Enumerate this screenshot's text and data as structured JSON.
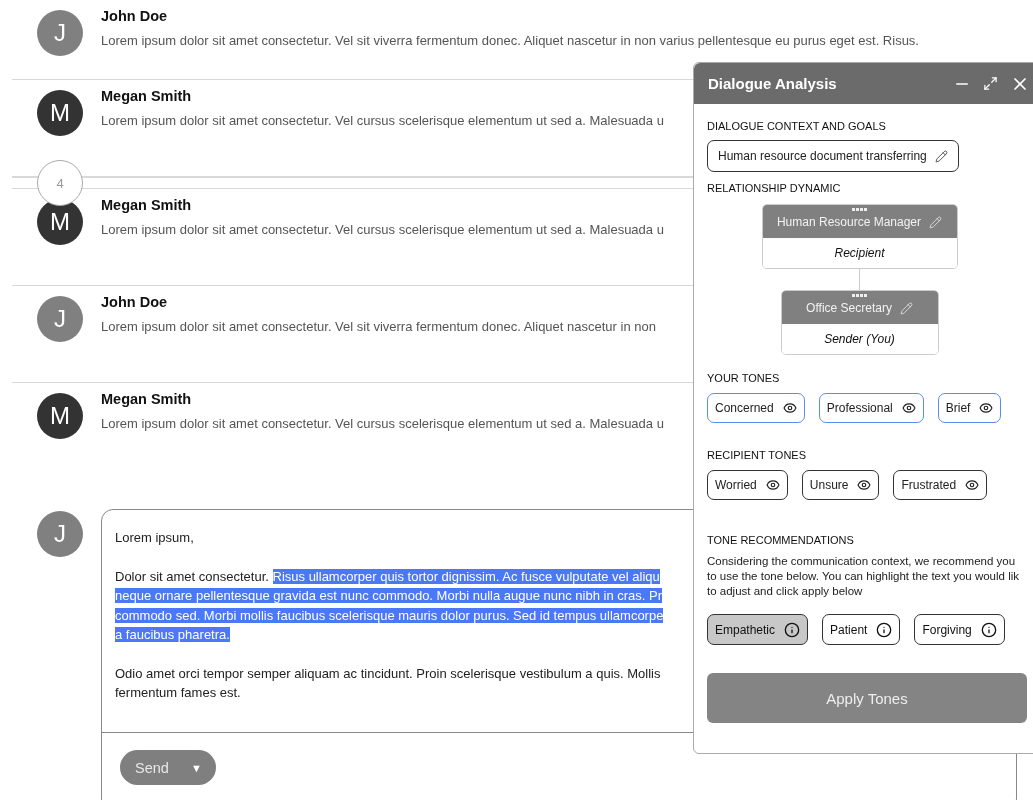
{
  "messages": [
    {
      "kind": "message",
      "author": "John Doe",
      "initial": "J",
      "color": "#808080",
      "text": "Lorem ipsum dolor sit amet consectetur. Vel sit viverra fermentum donec. Aliquet nascetur in non varius pellentesque eu purus eget est. Risus."
    },
    {
      "kind": "message",
      "author": "Megan Smith",
      "initial": "M",
      "color": "#333333",
      "text": "Lorem ipsum dolor sit amet consectetur. Vel cursus scelerisque elementum ut sed a. Malesuada u"
    },
    {
      "kind": "collapsed",
      "count": "4"
    },
    {
      "kind": "message",
      "author": "Megan Smith",
      "initial": "M",
      "color": "#333333",
      "text": "Lorem ipsum dolor sit amet consectetur. Vel cursus scelerisque elementum ut sed a. Malesuada u"
    },
    {
      "kind": "message",
      "author": "John Doe",
      "initial": "J",
      "color": "#808080",
      "text": "Lorem ipsum dolor sit amet consectetur. Vel sit viverra fermentum donec. Aliquet nascetur in non"
    },
    {
      "kind": "message",
      "author": "Megan Smith",
      "initial": "M",
      "color": "#333333",
      "text": "Lorem ipsum dolor sit amet consectetur. Vel cursus scelerisque elementum ut sed a. Malesuada u"
    }
  ],
  "composer": {
    "initial": "J",
    "color": "#808080",
    "paragraphs": [
      [
        [
          {
            "text": "Lorem ipsum,",
            "highlighted": false
          }
        ]
      ],
      [
        [
          {
            "text": "Dolor sit amet consectetur. ",
            "highlighted": false
          },
          {
            "text": "Risus ullamcorper quis tortor dignissim. Ac fusce vulputate vel aliqu",
            "highlighted": true
          }
        ],
        [
          {
            "text": "neque ornare pellentesque gravida est nunc commodo. Morbi nulla augue nunc nibh in cras. Pr",
            "highlighted": true
          }
        ],
        [
          {
            "text": "commodo sed. Morbi mollis faucibus scelerisque mauris dolor purus. Sed id tempus ullamcorpe",
            "highlighted": true
          }
        ],
        [
          {
            "text": "a faucibus pharetra. ",
            "highlighted": true
          }
        ]
      ],
      [
        [
          {
            "text": "Odio amet orci tempor semper aliquam ac tincidunt. Proin scelerisque vestibulum a quis. Mollis",
            "highlighted": false
          }
        ],
        [
          {
            "text": "fermentum fames est.",
            "highlighted": false
          }
        ]
      ]
    ],
    "send": {
      "label": "Send",
      "caret": "▼"
    }
  },
  "panel": {
    "title": "Dialogue Analysis",
    "context": {
      "heading": "DIALOGUE CONTEXT AND GOALS",
      "value": "Human resource document transferring"
    },
    "relationship": {
      "heading": "RELATIONSHIP DYNAMIC",
      "nodes": [
        {
          "name": "Human Resource Manager",
          "role": "Recipient"
        },
        {
          "name": "Office Secretary",
          "role": "Sender (You)"
        }
      ]
    },
    "your_tones": {
      "heading": "YOUR TONES",
      "tones": [
        {
          "label": "Concerned",
          "kind": "mine"
        },
        {
          "label": "Professional",
          "kind": "mine"
        },
        {
          "label": "Brief",
          "kind": "mine"
        }
      ]
    },
    "recipient_tones": {
      "heading": "RECIPIENT TONES",
      "tones": [
        {
          "label": "Worried",
          "kind": "theirs"
        },
        {
          "label": "Unsure",
          "kind": "theirs"
        },
        {
          "label": "Frustrated",
          "kind": "theirs"
        }
      ]
    },
    "recommendations": {
      "heading": "TONE RECOMMENDATIONS",
      "description": [
        "Considering the communication context, we recommend you",
        "to use the tone below. You can highlight the text you would lik",
        "to adjust and click apply below"
      ],
      "tones": [
        {
          "label": "Empathetic",
          "selected": true
        },
        {
          "label": "Patient",
          "selected": false
        },
        {
          "label": "Forgiving",
          "selected": false
        }
      ]
    },
    "apply": "Apply Tones"
  }
}
